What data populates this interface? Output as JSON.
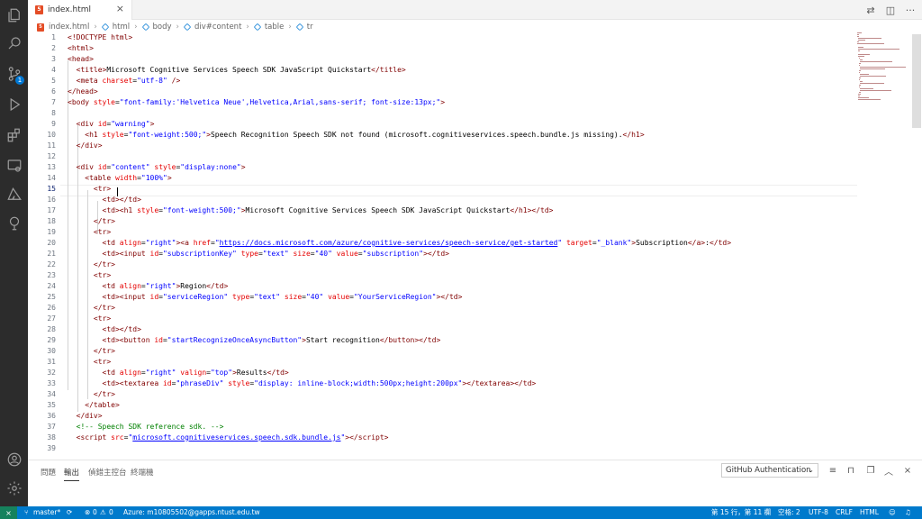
{
  "tab": {
    "icon_label": "5",
    "title": "index.html"
  },
  "breadcrumb": [
    {
      "label": "index.html",
      "icon": "html5-icon"
    },
    {
      "label": "html",
      "icon": "element-icon"
    },
    {
      "label": "body",
      "icon": "element-icon"
    },
    {
      "label": "div#content",
      "icon": "element-icon"
    },
    {
      "label": "table",
      "icon": "element-icon"
    },
    {
      "label": "tr",
      "icon": "element-icon"
    }
  ],
  "activity": {
    "scm_badge": "1"
  },
  "editor": {
    "current_line": 15,
    "lines": [
      [
        [
          "tg",
          "<!DOCTYPE html>"
        ]
      ],
      [
        [
          "tg",
          "<html>"
        ]
      ],
      [
        [
          "tg",
          "<head>"
        ]
      ],
      [
        [
          "",
          "  "
        ],
        [
          "tg",
          "<title>"
        ],
        [
          "",
          "Microsoft Cognitive Services Speech SDK JavaScript Quickstart"
        ],
        [
          "tg",
          "</title>"
        ]
      ],
      [
        [
          "",
          "  "
        ],
        [
          "tg",
          "<meta "
        ],
        [
          "an",
          "charset"
        ],
        [
          "",
          "="
        ],
        [
          "av",
          "\"utf-8\""
        ],
        [
          "tg",
          " />"
        ]
      ],
      [
        [
          "tg",
          "</head>"
        ]
      ],
      [
        [
          "tg",
          "<body "
        ],
        [
          "an",
          "style"
        ],
        [
          "",
          "="
        ],
        [
          "av",
          "\"font-family:'Helvetica Neue',Helvetica,Arial,sans-serif; font-size:13px;\""
        ],
        [
          "tg",
          ">"
        ]
      ],
      [
        [
          "",
          ""
        ]
      ],
      [
        [
          "",
          "  "
        ],
        [
          "tg",
          "<div "
        ],
        [
          "an",
          "id"
        ],
        [
          "",
          "="
        ],
        [
          "av",
          "\"warning\""
        ],
        [
          "tg",
          ">"
        ]
      ],
      [
        [
          "",
          "    "
        ],
        [
          "tg",
          "<h1 "
        ],
        [
          "an",
          "style"
        ],
        [
          "",
          "="
        ],
        [
          "av",
          "\"font-weight:500;\""
        ],
        [
          "tg",
          ">"
        ],
        [
          "",
          "Speech Recognition Speech SDK not found (microsoft.cognitiveservices.speech.bundle.js missing)."
        ],
        [
          "tg",
          "</h1>"
        ]
      ],
      [
        [
          "",
          "  "
        ],
        [
          "tg",
          "</div>"
        ]
      ],
      [
        [
          "",
          ""
        ]
      ],
      [
        [
          "",
          "  "
        ],
        [
          "tg",
          "<div "
        ],
        [
          "an",
          "id"
        ],
        [
          "",
          "="
        ],
        [
          "av",
          "\"content\""
        ],
        [
          "an",
          " style"
        ],
        [
          "",
          "="
        ],
        [
          "av",
          "\"display:none\""
        ],
        [
          "tg",
          ">"
        ]
      ],
      [
        [
          "",
          "    "
        ],
        [
          "tg",
          "<table "
        ],
        [
          "an",
          "width"
        ],
        [
          "",
          "="
        ],
        [
          "av",
          "\"100%\""
        ],
        [
          "tg",
          ">"
        ]
      ],
      [
        [
          "",
          "      "
        ],
        [
          "tg",
          "<tr>"
        ]
      ],
      [
        [
          "",
          "        "
        ],
        [
          "tg",
          "<td></td>"
        ]
      ],
      [
        [
          "",
          "        "
        ],
        [
          "tg",
          "<td>"
        ],
        [
          "tg",
          "<h1 "
        ],
        [
          "an",
          "style"
        ],
        [
          "",
          "="
        ],
        [
          "av",
          "\"font-weight:500;\""
        ],
        [
          "tg",
          ">"
        ],
        [
          "",
          "Microsoft Cognitive Services Speech SDK JavaScript Quickstart"
        ],
        [
          "tg",
          "</h1></td>"
        ]
      ],
      [
        [
          "",
          "      "
        ],
        [
          "tg",
          "</tr>"
        ]
      ],
      [
        [
          "",
          "      "
        ],
        [
          "tg",
          "<tr>"
        ]
      ],
      [
        [
          "",
          "        "
        ],
        [
          "tg",
          "<td "
        ],
        [
          "an",
          "align"
        ],
        [
          "",
          "="
        ],
        [
          "av",
          "\"right\""
        ],
        [
          "tg",
          ">"
        ],
        [
          "tg",
          "<a "
        ],
        [
          "an",
          "href"
        ],
        [
          "",
          "="
        ],
        [
          "av",
          "\""
        ],
        [
          "lk",
          "https://docs.microsoft.com/azure/cognitive-services/speech-service/get-started"
        ],
        [
          "av",
          "\""
        ],
        [
          "an",
          " target"
        ],
        [
          "",
          "="
        ],
        [
          "av",
          "\"_blank\""
        ],
        [
          "tg",
          ">"
        ],
        [
          "",
          "Subscription"
        ],
        [
          "tg",
          "</a>"
        ],
        [
          "",
          ":"
        ],
        [
          "tg",
          "</td>"
        ]
      ],
      [
        [
          "",
          "        "
        ],
        [
          "tg",
          "<td>"
        ],
        [
          "tg",
          "<input "
        ],
        [
          "an",
          "id"
        ],
        [
          "",
          "="
        ],
        [
          "av",
          "\"subscriptionKey\""
        ],
        [
          "an",
          " type"
        ],
        [
          "",
          "="
        ],
        [
          "av",
          "\"text\""
        ],
        [
          "an",
          " size"
        ],
        [
          "",
          "="
        ],
        [
          "av",
          "\"40\""
        ],
        [
          "an",
          " value"
        ],
        [
          "",
          "="
        ],
        [
          "av",
          "\"subscription\""
        ],
        [
          "tg",
          "></td>"
        ]
      ],
      [
        [
          "",
          "      "
        ],
        [
          "tg",
          "</tr>"
        ]
      ],
      [
        [
          "",
          "      "
        ],
        [
          "tg",
          "<tr>"
        ]
      ],
      [
        [
          "",
          "        "
        ],
        [
          "tg",
          "<td "
        ],
        [
          "an",
          "align"
        ],
        [
          "",
          "="
        ],
        [
          "av",
          "\"right\""
        ],
        [
          "tg",
          ">"
        ],
        [
          "",
          "Region"
        ],
        [
          "tg",
          "</td>"
        ]
      ],
      [
        [
          "",
          "        "
        ],
        [
          "tg",
          "<td>"
        ],
        [
          "tg",
          "<input "
        ],
        [
          "an",
          "id"
        ],
        [
          "",
          "="
        ],
        [
          "av",
          "\"serviceRegion\""
        ],
        [
          "an",
          " type"
        ],
        [
          "",
          "="
        ],
        [
          "av",
          "\"text\""
        ],
        [
          "an",
          " size"
        ],
        [
          "",
          "="
        ],
        [
          "av",
          "\"40\""
        ],
        [
          "an",
          " value"
        ],
        [
          "",
          "="
        ],
        [
          "av",
          "\"YourServiceRegion\""
        ],
        [
          "tg",
          "></td>"
        ]
      ],
      [
        [
          "",
          "      "
        ],
        [
          "tg",
          "</tr>"
        ]
      ],
      [
        [
          "",
          "      "
        ],
        [
          "tg",
          "<tr>"
        ]
      ],
      [
        [
          "",
          "        "
        ],
        [
          "tg",
          "<td></td>"
        ]
      ],
      [
        [
          "",
          "        "
        ],
        [
          "tg",
          "<td>"
        ],
        [
          "tg",
          "<button "
        ],
        [
          "an",
          "id"
        ],
        [
          "",
          "="
        ],
        [
          "av",
          "\"startRecognizeOnceAsyncButton\""
        ],
        [
          "tg",
          ">"
        ],
        [
          "",
          "Start recognition"
        ],
        [
          "tg",
          "</button></td>"
        ]
      ],
      [
        [
          "",
          "      "
        ],
        [
          "tg",
          "</tr>"
        ]
      ],
      [
        [
          "",
          "      "
        ],
        [
          "tg",
          "<tr>"
        ]
      ],
      [
        [
          "",
          "        "
        ],
        [
          "tg",
          "<td "
        ],
        [
          "an",
          "align"
        ],
        [
          "",
          "="
        ],
        [
          "av",
          "\"right\""
        ],
        [
          "an",
          " valign"
        ],
        [
          "",
          "="
        ],
        [
          "av",
          "\"top\""
        ],
        [
          "tg",
          ">"
        ],
        [
          "",
          "Results"
        ],
        [
          "tg",
          "</td>"
        ]
      ],
      [
        [
          "",
          "        "
        ],
        [
          "tg",
          "<td>"
        ],
        [
          "tg",
          "<textarea "
        ],
        [
          "an",
          "id"
        ],
        [
          "",
          "="
        ],
        [
          "av",
          "\"phraseDiv\""
        ],
        [
          "an",
          " style"
        ],
        [
          "",
          "="
        ],
        [
          "av",
          "\"display: inline-block;width:500px;height:200px\""
        ],
        [
          "tg",
          "></textarea></td>"
        ]
      ],
      [
        [
          "",
          "      "
        ],
        [
          "tg",
          "</tr>"
        ]
      ],
      [
        [
          "",
          "    "
        ],
        [
          "tg",
          "</table>"
        ]
      ],
      [
        [
          "",
          "  "
        ],
        [
          "tg",
          "</div>"
        ]
      ],
      [
        [
          "",
          "  "
        ],
        [
          "cm",
          "<!-- Speech SDK reference sdk. -->"
        ]
      ],
      [
        [
          "",
          "  "
        ],
        [
          "tg",
          "<script "
        ],
        [
          "an",
          "src"
        ],
        [
          "",
          "="
        ],
        [
          "av",
          "\""
        ],
        [
          "lk",
          "microsoft.cognitiveservices.speech.sdk.bundle.js"
        ],
        [
          "av",
          "\""
        ],
        [
          "tg",
          "></"
        ],
        [
          "tg",
          "script>"
        ]
      ],
      [
        [
          "",
          ""
        ]
      ]
    ]
  },
  "panel": {
    "tabs": [
      "問題",
      "輸出",
      "偵錯主控台",
      "終端機"
    ],
    "active_tab": 1,
    "output_channel": "GitHub Authentication"
  },
  "status": {
    "branch": "master*",
    "errors": "0",
    "warnings": "0",
    "azure": "Azure: m10805502@gapps.ntust.edu.tw",
    "position": "第 15 行，第 11 欄",
    "spaces": "空格: 2",
    "encoding": "UTF-8",
    "eol": "CRLF",
    "language": "HTML"
  },
  "colors": {
    "activity_bar": "#2c2c2c",
    "status_bar": "#007acc",
    "remote": "#16825d",
    "tag": "#800000",
    "attribute": "#e50000",
    "value": "#0000ff",
    "comment": "#008000"
  }
}
